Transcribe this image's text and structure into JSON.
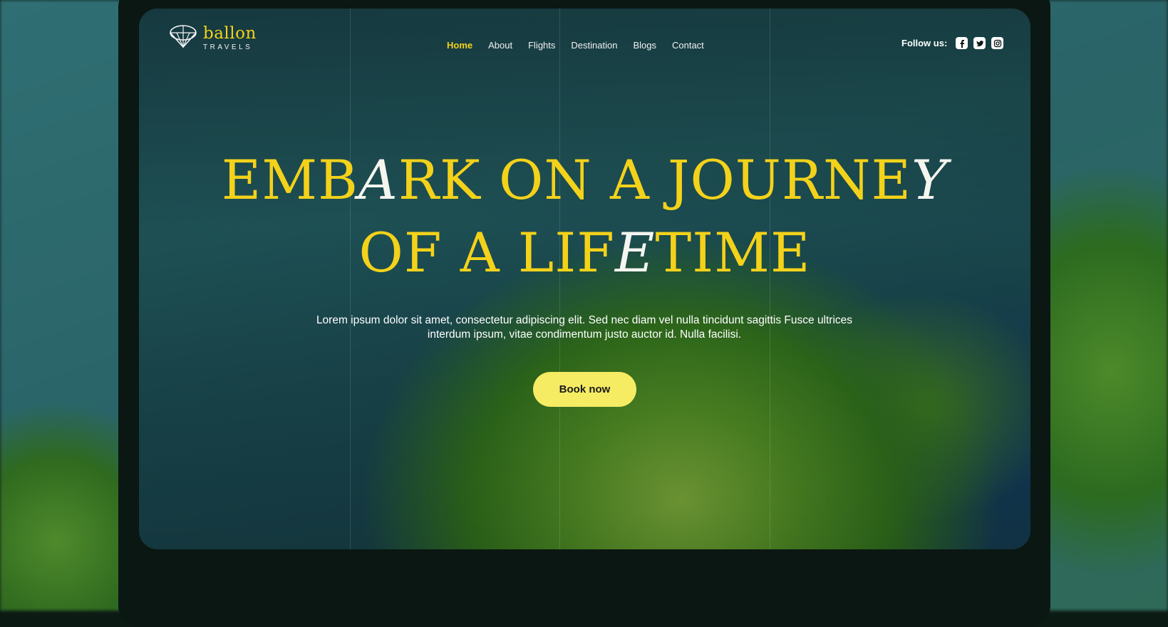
{
  "brand": {
    "name": "ballon",
    "tagline": "TRAVELS"
  },
  "nav": {
    "items": [
      {
        "label": "Home",
        "active": true
      },
      {
        "label": "About"
      },
      {
        "label": "Flights"
      },
      {
        "label": "Destination"
      },
      {
        "label": "Blogs"
      },
      {
        "label": "Contact"
      }
    ]
  },
  "social": {
    "label": "Follow us:",
    "icons": [
      "facebook-icon",
      "twitter-icon",
      "instagram-icon"
    ]
  },
  "hero": {
    "headline_line1_a": "EMB",
    "headline_line1_hi1": "A",
    "headline_line1_b": "RK ON A JOURNE",
    "headline_line1_hi2": "Y",
    "headline_line2_a": "OF A LIF",
    "headline_line2_hi": "E",
    "headline_line2_b": "TIME",
    "description": "Lorem ipsum dolor sit amet, consectetur adipiscing elit. Sed nec diam vel nulla tincidunt sagittis Fusce ultrices interdum ipsum, vitae condimentum justo auctor id. Nulla facilisi.",
    "cta_label": "Book now"
  },
  "colors": {
    "accent": "#f4d21a",
    "button": "#f6ec64",
    "frame": "#0b1712"
  }
}
